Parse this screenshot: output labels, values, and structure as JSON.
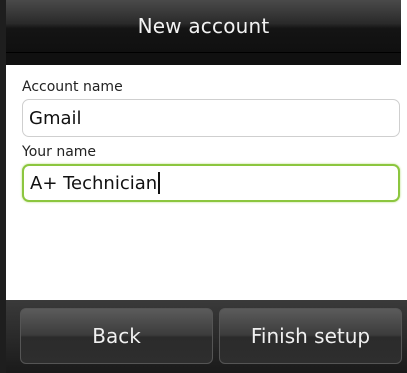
{
  "header": {
    "title": "New account"
  },
  "form": {
    "account_name": {
      "label": "Account name",
      "value": "Gmail"
    },
    "your_name": {
      "label": "Your name",
      "value": "A+ Technician"
    }
  },
  "buttons": {
    "back_label": "Back",
    "finish_label": "Finish setup"
  },
  "colors": {
    "focus_border": "#8cc63f",
    "titlebar": "#1a1a1a"
  }
}
